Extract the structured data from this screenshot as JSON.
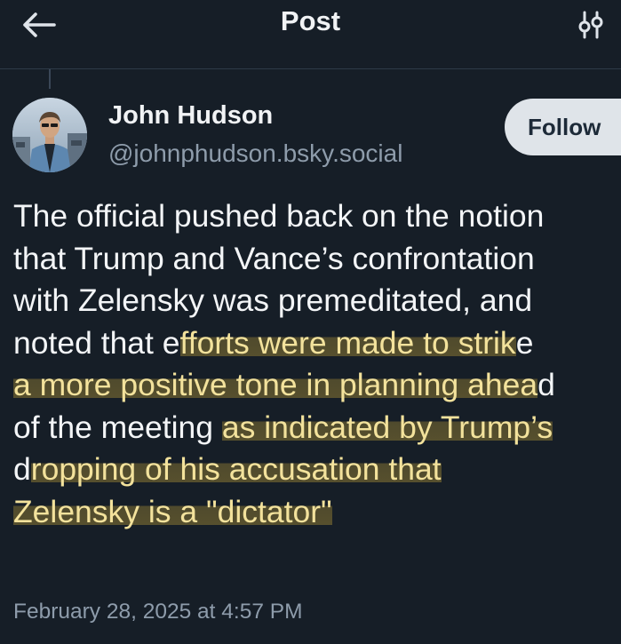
{
  "header": {
    "title": "Post",
    "back_icon": "arrow-left-icon",
    "settings_icon": "sliders-icon"
  },
  "author": {
    "name": "John Hudson",
    "handle": "@johnphudson.bsky.social",
    "follow_label": "Follow"
  },
  "post": {
    "lines": [
      [
        {
          "text": "The official pushed back on the notion",
          "hl": false
        }
      ],
      [
        {
          "text": "that Trump and Vance’s confrontation",
          "hl": false
        }
      ],
      [
        {
          "text": "with Zelensky was premeditated, and",
          "hl": false
        }
      ],
      [
        {
          "text": "noted that e",
          "hl": false
        },
        {
          "text": "fforts were made to strik",
          "hl": true
        },
        {
          "text": "e",
          "hl": false
        }
      ],
      [
        {
          "text": "a more positive tone in planning ahea",
          "hl": true
        },
        {
          "text": "d",
          "hl": false
        }
      ],
      [
        {
          "text": "of the meeting ",
          "hl": false
        },
        {
          "text": "as indicated by Trump’s",
          "hl": true
        }
      ],
      [
        {
          "text": "d",
          "hl": false
        },
        {
          "text": "ropping of his accusation that",
          "hl": true
        }
      ],
      [
        {
          "text": "Zelensky is a \"dictator\"",
          "hl": true
        }
      ]
    ],
    "timestamp": "February 28, 2025 at 4:57 PM"
  },
  "colors": {
    "background": "#161e27",
    "text": "#f3f5f7",
    "muted": "#8e9cab",
    "highlight": "#d4b03a",
    "follow_bg": "#dfe4e9"
  }
}
